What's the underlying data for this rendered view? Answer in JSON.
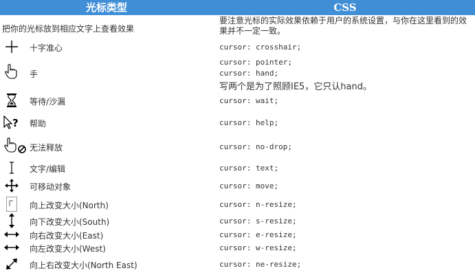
{
  "header": {
    "col1": "光标类型",
    "col2": "CSS"
  },
  "intro": {
    "left": "把你的光标放到相应文字上查看效果",
    "right": "要注意光标的实际效果依赖于用户的系统设置，与你在这里看到的效果并不一定一致。"
  },
  "rows": [
    {
      "icon": "crosshair-icon",
      "label": "十字准心",
      "css": "cursor: crosshair;"
    },
    {
      "icon": "hand-pointer-icon",
      "label": "手",
      "css": "cursor: pointer;",
      "css2": "cursor: hand;",
      "note": "写两个是为了照顾IE5，它只认hand。"
    },
    {
      "icon": "hourglass-icon",
      "label": "等待/沙漏",
      "css": "cursor: wait;"
    },
    {
      "icon": "help-icon",
      "label": "帮助",
      "css": "cursor: help;"
    },
    {
      "icon": "no-drop-icon",
      "label": "无法释放",
      "css": "cursor: no-drop;"
    },
    {
      "icon": "text-ibeam-icon",
      "label": "文字/编辑",
      "css": "cursor: text;"
    },
    {
      "icon": "move-icon",
      "label": "可移动对象",
      "css": "cursor: move;"
    },
    {
      "icon": "n-resize-icon",
      "label": "向上改变大小(North)",
      "css": "cursor: n-resize;"
    },
    {
      "icon": "s-resize-icon",
      "label": "向下改变大小(South)",
      "css": "cursor: s-resize;"
    },
    {
      "icon": "e-resize-icon",
      "label": "向右改变大小(East)",
      "css": "cursor: e-resize;"
    },
    {
      "icon": "w-resize-icon",
      "label": "向左改变大小(West)",
      "css": "cursor: w-resize;"
    },
    {
      "icon": "ne-resize-icon",
      "label": "向上右改变大小(North East)",
      "css": "cursor: ne-resize;"
    }
  ]
}
